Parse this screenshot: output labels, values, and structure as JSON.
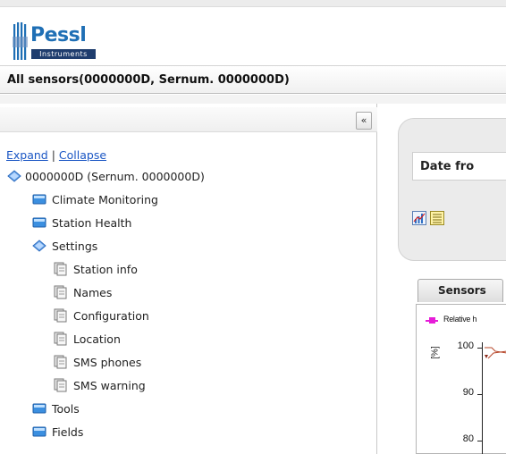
{
  "header": {
    "logo_text": "Pessl",
    "logo_subtext": "Instruments",
    "title": "All sensors(0000000D, Sernum. 0000000D)"
  },
  "left_panel": {
    "collapse_button": "«",
    "expand_label": "Expand",
    "separator": " | ",
    "collapse_label": "Collapse",
    "tree": {
      "root": "0000000D (Sernum. 0000000D)",
      "climate_monitoring": "Climate Monitoring",
      "station_health": "Station Health",
      "settings": "Settings",
      "station_info": "Station info",
      "names": "Names",
      "configuration": "Configuration",
      "location": "Location",
      "sms_phones": "SMS phones",
      "sms_warning": "SMS warning",
      "tools": "Tools",
      "fields": "Fields"
    }
  },
  "right_panel": {
    "date_label": "Date fro",
    "tab_sensors": "Sensors"
  },
  "chart_data": {
    "type": "line",
    "legend": [
      "Relative h"
    ],
    "ylabel": "[%]",
    "yticks": [
      100,
      90,
      80
    ],
    "series": [
      {
        "name": "Relative h",
        "color": "#e61cd8"
      }
    ]
  },
  "colors": {
    "link": "#1a56c4",
    "brand": "#1f6fb5",
    "series": "#e61cd8"
  }
}
